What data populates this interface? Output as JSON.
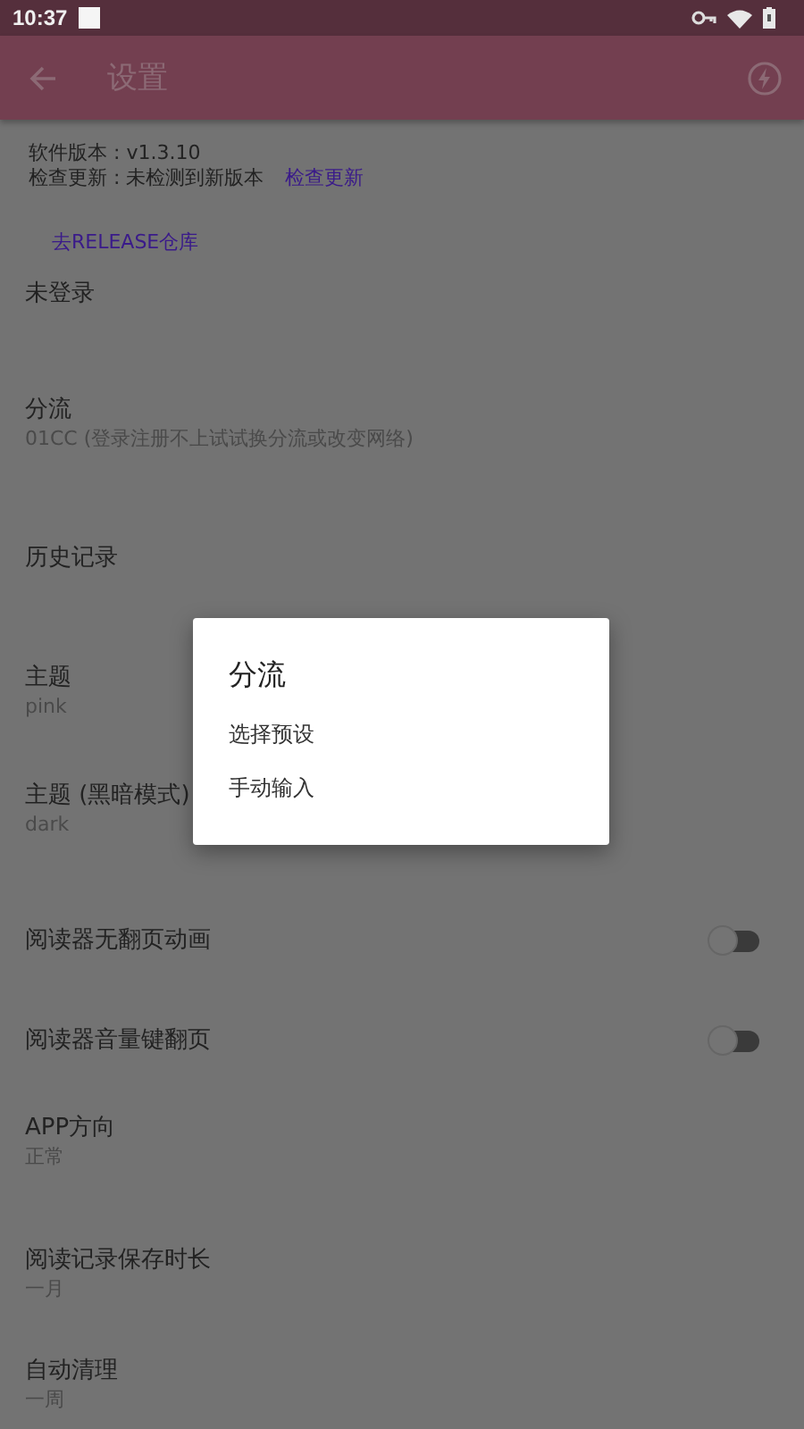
{
  "status_bar": {
    "time": "10:37"
  },
  "app_bar": {
    "title": "设置"
  },
  "about": {
    "version": "软件版本 : v1.3.10",
    "update_status": "检查更新 : 未检测到新版本",
    "update_link": "检查更新",
    "repo_link": "去RELEASE仓库"
  },
  "settings": [
    {
      "kind": "plain",
      "title": "未登录"
    },
    {
      "kind": "plain",
      "title": "分流",
      "subtitle": "01CC (登录注册不上试试换分流或改变网络)"
    },
    {
      "kind": "plain",
      "title": "历史记录"
    },
    {
      "kind": "plain",
      "title": "主题",
      "subtitle": "pink"
    },
    {
      "kind": "plain",
      "title": "主题 (黑暗模式)",
      "subtitle": "dark"
    },
    {
      "kind": "switch",
      "title": "阅读器无翻页动画",
      "on": false
    },
    {
      "kind": "switch",
      "title": "阅读器音量键翻页",
      "on": false
    },
    {
      "kind": "plain",
      "title": "APP方向",
      "subtitle": "正常"
    },
    {
      "kind": "plain",
      "title": "阅读记录保存时长",
      "subtitle": "一月"
    },
    {
      "kind": "plain",
      "title": "自动清理",
      "subtitle": "一周"
    }
  ],
  "dialog": {
    "title": "分流",
    "options": [
      "选择预设",
      "手动输入"
    ]
  }
}
